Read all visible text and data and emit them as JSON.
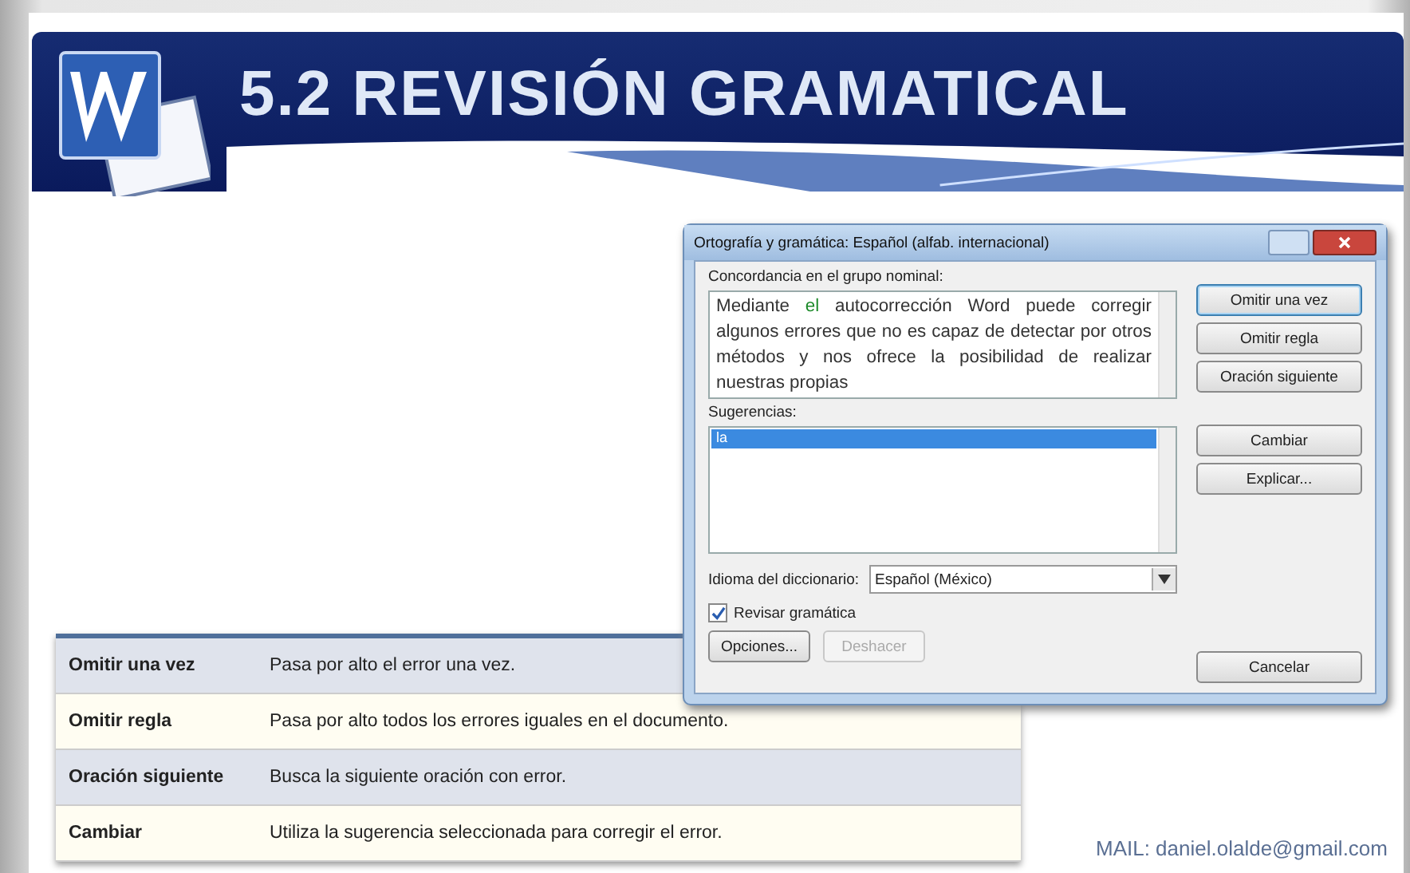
{
  "slide": {
    "title": "5.2 REVISIÓN GRAMATICAL",
    "footer": "MAIL: daniel.olalde@gmail.com"
  },
  "dialog": {
    "title": "Ortografía y gramática: Español (alfab. internacional)",
    "error_label": "Concordancia en el grupo nominal:",
    "sentence_parts": [
      {
        "text": "Mediante ",
        "flagged": false
      },
      {
        "text": "el",
        "flagged": true
      },
      {
        "text": " autocorrección Word puede corregir algunos errores que no es capaz de detectar por otros métodos y nos ofrece la posibilidad de realizar nuestras propias",
        "flagged": false
      }
    ],
    "suggestions_label": "Sugerencias:",
    "suggestions": [
      {
        "text": "la",
        "selected": true
      }
    ],
    "language_label": "Idioma del diccionario:",
    "language": "Español (México)",
    "grammar_check": {
      "label": "Revisar gramática",
      "checked": true
    },
    "side_buttons": [
      {
        "label": "Omitir una vez",
        "default": true
      },
      {
        "label": "Omitir regla",
        "default": false
      },
      {
        "label": "Oración siguiente",
        "default": false
      },
      {
        "label": "Cambiar",
        "default": false
      },
      {
        "label": "Explicar...",
        "default": false
      }
    ],
    "bottom_buttons": [
      {
        "label": "Opciones...",
        "disabled": false
      },
      {
        "label": "Deshacer",
        "disabled": true
      }
    ],
    "cancel": "Cancelar"
  },
  "table": {
    "rows": [
      {
        "term": "Omitir una vez",
        "description": "Pasa por alto el error una vez."
      },
      {
        "term": "Omitir regla",
        "description": "Pasa por alto todos los errores iguales en el documento."
      },
      {
        "term": "Oración siguiente",
        "description": "Busca la siguiente oración con error."
      },
      {
        "term": "Cambiar",
        "description": "Utiliza la sugerencia seleccionada para corregir el error."
      }
    ]
  }
}
